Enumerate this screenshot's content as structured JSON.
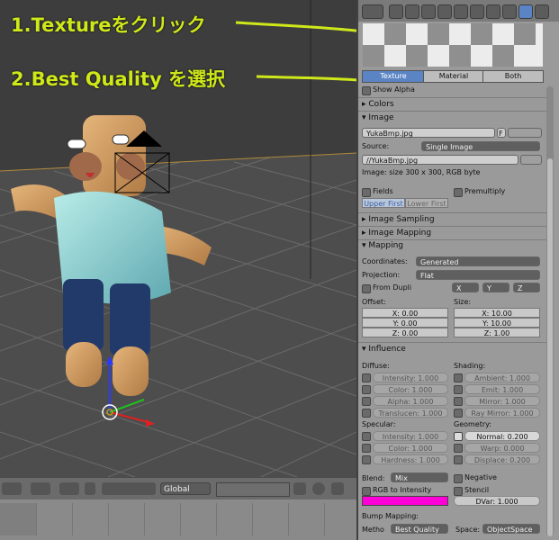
{
  "annotations": {
    "step1": "1.Textureをクリック",
    "step2": "2.Best Quality を選択"
  },
  "tabs": {
    "texture": "Texture",
    "material": "Material",
    "both": "Both"
  },
  "rows": {
    "show_alpha": "Show Alpha",
    "colors": "Colors",
    "image": "Image"
  },
  "image": {
    "name": "YukaBmp.jpg",
    "source_label": "Source:",
    "source_value": "Single Image",
    "path": "//YukaBmp.jpg",
    "info": "Image: size 300 x 300, RGB byte",
    "fields": "Fields",
    "premultiply": "Premultiply",
    "upper_first": "Upper First",
    "lower_first": "Lower First",
    "f_button": "F"
  },
  "sections": {
    "image_sampling": "Image Sampling",
    "image_mapping": "Image Mapping",
    "mapping": "Mapping",
    "influence": "Influence"
  },
  "mapping": {
    "coordinates_label": "Coordinates:",
    "coordinates_value": "Generated",
    "projection_label": "Projection:",
    "projection_value": "Flat",
    "from_dupli": "From Dupli",
    "x": "X",
    "y": "Y",
    "z": "Z",
    "offset_label": "Offset:",
    "size_label": "Size:",
    "offset": [
      "X: 0.00",
      "Y: 0.00",
      "Z: 0.00"
    ],
    "size": [
      "X: 10.00",
      "Y: 10.00",
      "Z: 1.00"
    ]
  },
  "influence": {
    "diffuse_label": "Diffuse:",
    "shading_label": "Shading:",
    "diffuse": [
      "Intensity: 1.000",
      "Color: 1.000",
      "Alpha: 1.000",
      "Translucen: 1.000"
    ],
    "shading": [
      "Ambient: 1.000",
      "Emit: 1.000",
      "Mirror: 1.000",
      "Ray Mirror: 1.000"
    ],
    "specular_label": "Specular:",
    "geometry_label": "Geometry:",
    "specular": [
      "Intensity: 1.000",
      "Color: 1.000",
      "Hardness: 1.000"
    ],
    "geometry": [
      "Normal: 0.200",
      "Warp: 0.000",
      "Displace: 0.200"
    ]
  },
  "blend": {
    "label": "Blend:",
    "value": "Mix",
    "negative": "Negative",
    "rgb_to_intensity": "RGB to Intensity",
    "stencil": "Stencil",
    "dvar": "DVar: 1.000",
    "color": "#ff00d8"
  },
  "bump": {
    "label": "Bump Mapping:",
    "method_label": "Metho",
    "method_value": "Best Quality",
    "space_label": "Space:",
    "space_value": "ObjectSpace"
  },
  "toolbar": {
    "orientation": "Global"
  },
  "colors": {
    "annotation": "#cfe81a",
    "tab_active": "#5a84c4",
    "magenta": "#ff00d8"
  }
}
